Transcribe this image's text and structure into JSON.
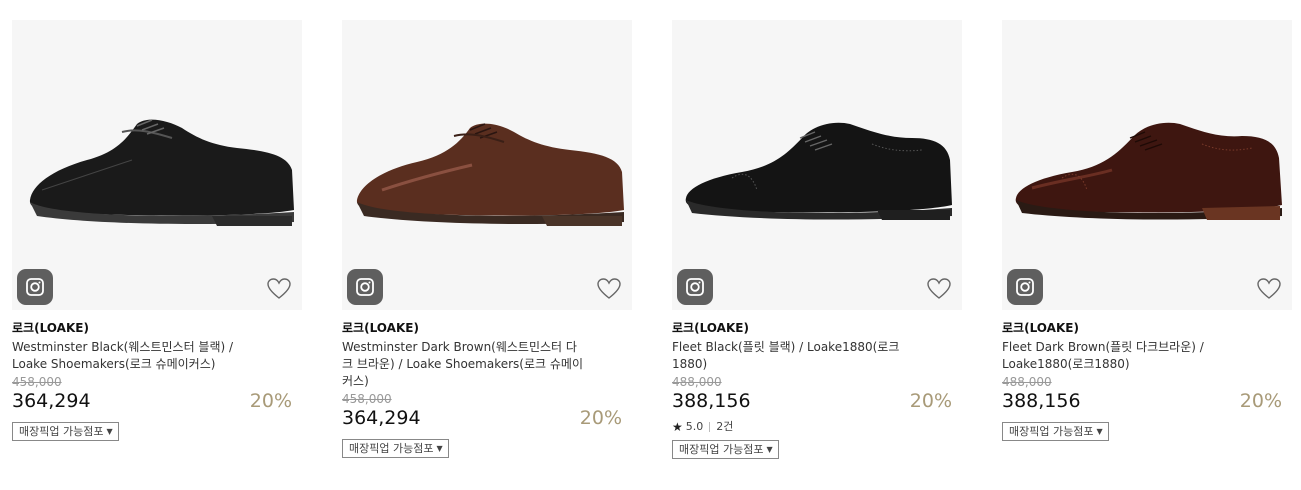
{
  "products": [
    {
      "brand": "로크(LOAKE)",
      "name": "Westminster Black(웨스트민스터 블랙) / Loake Shoemakers(로크 슈메이커스)",
      "original_price": "458,000",
      "price": "364,294",
      "discount": "20%",
      "pickup_label": "매장픽업 가능점포",
      "shoe_color": "#1a1a1a",
      "shoe_style": "derby"
    },
    {
      "brand": "로크(LOAKE)",
      "name": "Westminster Dark Brown(웨스트민스터 다크 브라운) / Loake Shoemakers(로크 슈메이커스)",
      "original_price": "458,000",
      "price": "364,294",
      "discount": "20%",
      "pickup_label": "매장픽업 가능점포",
      "shoe_color": "#5a2e1f",
      "shoe_style": "derby"
    },
    {
      "brand": "로크(LOAKE)",
      "name": "Fleet Black(플릿 블랙) / Loake1880(로크1880)",
      "original_price": "488,000",
      "price": "388,156",
      "discount": "20%",
      "rating": "5.0",
      "review_count": "2건",
      "pickup_label": "매장픽업 가능점포",
      "shoe_color": "#141414",
      "shoe_style": "oxford"
    },
    {
      "brand": "로크(LOAKE)",
      "name": "Fleet Dark Brown(플릿 다크브라운) / Loake1880(로크1880)",
      "original_price": "488,000",
      "price": "388,156",
      "discount": "20%",
      "pickup_label": "매장픽업 가능점포",
      "shoe_color": "#3e1610",
      "shoe_style": "oxford"
    }
  ],
  "icons": {
    "instagram": "instagram-icon",
    "wishlist": "heart-icon",
    "dropdown": "caret-down-icon",
    "star": "star-icon"
  },
  "colors": {
    "discount": "#a89a78",
    "image_bg": "#f6f6f6",
    "insta_bg": "#5f5f5f"
  }
}
